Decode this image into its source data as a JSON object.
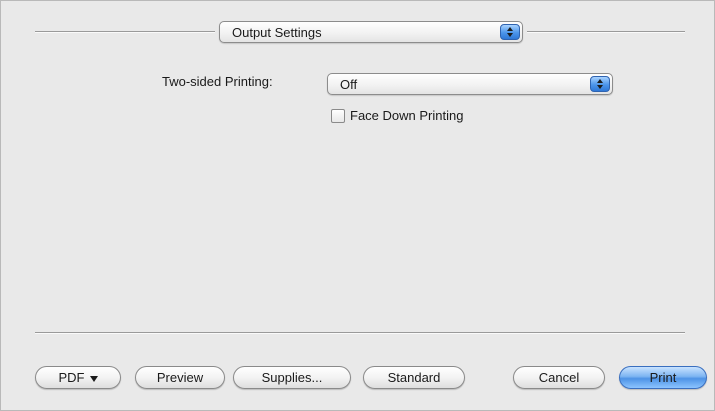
{
  "panel_menu": {
    "selected": "Output Settings"
  },
  "two_sided": {
    "label": "Two-sided Printing:",
    "selected": "Off"
  },
  "face_down": {
    "label": "Face Down Printing",
    "checked": false
  },
  "buttons": {
    "pdf": "PDF",
    "preview": "Preview",
    "supplies": "Supplies...",
    "standard": "Standard",
    "cancel": "Cancel",
    "print": "Print"
  }
}
